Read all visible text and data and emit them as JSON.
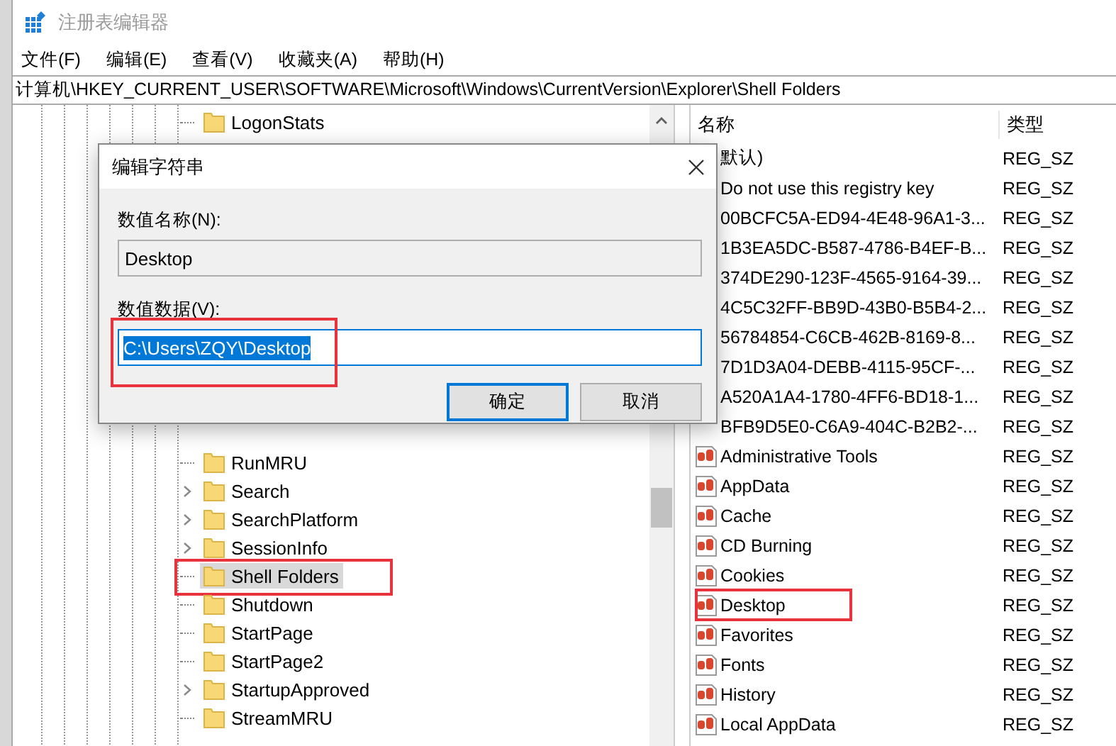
{
  "window": {
    "title": "注册表编辑器"
  },
  "menu": [
    "文件(F)",
    "编辑(E)",
    "查看(V)",
    "收藏夹(A)",
    "帮助(H)"
  ],
  "address": "计算机\\HKEY_CURRENT_USER\\SOFTWARE\\Microsoft\\Windows\\CurrentVersion\\Explorer\\Shell Folders",
  "tree": {
    "items_above": [
      {
        "label": "LogonStats",
        "expandable": false,
        "selected": false,
        "marked": false
      }
    ],
    "items_below": [
      {
        "label": "RunMRU",
        "expandable": false,
        "selected": false,
        "marked": false
      },
      {
        "label": "Search",
        "expandable": true,
        "selected": false,
        "marked": false
      },
      {
        "label": "SearchPlatform",
        "expandable": true,
        "selected": false,
        "marked": false
      },
      {
        "label": "SessionInfo",
        "expandable": true,
        "selected": false,
        "marked": false
      },
      {
        "label": "Shell Folders",
        "expandable": false,
        "selected": true,
        "marked": true
      },
      {
        "label": "Shutdown",
        "expandable": false,
        "selected": false,
        "marked": false
      },
      {
        "label": "StartPage",
        "expandable": false,
        "selected": false,
        "marked": false
      },
      {
        "label": "StartPage2",
        "expandable": false,
        "selected": false,
        "marked": false
      },
      {
        "label": "StartupApproved",
        "expandable": true,
        "selected": false,
        "marked": false
      },
      {
        "label": "StreamMRU",
        "expandable": false,
        "selected": false,
        "marked": false
      }
    ]
  },
  "list": {
    "columns": [
      "名称",
      "类型"
    ],
    "rows": [
      {
        "kind": "covered",
        "name": "默认)",
        "type": "REG_SZ",
        "marked": false
      },
      {
        "kind": "covered",
        "name": "Do not use this registry key",
        "type": "REG_SZ",
        "marked": false
      },
      {
        "kind": "covered",
        "name": "00BCFC5A-ED94-4E48-96A1-3...",
        "type": "REG_SZ",
        "marked": false
      },
      {
        "kind": "covered",
        "name": "1B3EA5DC-B587-4786-B4EF-B...",
        "type": "REG_SZ",
        "marked": false
      },
      {
        "kind": "covered",
        "name": "374DE290-123F-4565-9164-39...",
        "type": "REG_SZ",
        "marked": false
      },
      {
        "kind": "covered",
        "name": "4C5C32FF-BB9D-43B0-B5B4-2...",
        "type": "REG_SZ",
        "marked": false
      },
      {
        "kind": "covered",
        "name": "56784854-C6CB-462B-8169-8...",
        "type": "REG_SZ",
        "marked": false
      },
      {
        "kind": "covered",
        "name": "7D1D3A04-DEBB-4115-95CF-...",
        "type": "REG_SZ",
        "marked": false
      },
      {
        "kind": "covered",
        "name": "A520A1A4-1780-4FF6-BD18-1...",
        "type": "REG_SZ",
        "marked": false
      },
      {
        "kind": "covered",
        "name": "BFB9D5E0-C6A9-404C-B2B2-...",
        "type": "REG_SZ",
        "marked": false
      },
      {
        "kind": "string",
        "name": "Administrative Tools",
        "type": "REG_SZ",
        "marked": false
      },
      {
        "kind": "string",
        "name": "AppData",
        "type": "REG_SZ",
        "marked": false
      },
      {
        "kind": "string",
        "name": "Cache",
        "type": "REG_SZ",
        "marked": false
      },
      {
        "kind": "string",
        "name": "CD Burning",
        "type": "REG_SZ",
        "marked": false
      },
      {
        "kind": "string",
        "name": "Cookies",
        "type": "REG_SZ",
        "marked": false
      },
      {
        "kind": "string",
        "name": "Desktop",
        "type": "REG_SZ",
        "marked": true
      },
      {
        "kind": "string",
        "name": "Favorites",
        "type": "REG_SZ",
        "marked": false
      },
      {
        "kind": "string",
        "name": "Fonts",
        "type": "REG_SZ",
        "marked": false
      },
      {
        "kind": "string",
        "name": "History",
        "type": "REG_SZ",
        "marked": false
      },
      {
        "kind": "string",
        "name": "Local AppData",
        "type": "REG_SZ",
        "marked": false
      }
    ]
  },
  "dialog": {
    "title": "编辑字符串",
    "name_label": "数值名称(N):",
    "name_value": "Desktop",
    "data_label": "数值数据(V):",
    "data_value": "C:\\Users\\ZQY\\Desktop",
    "data_selected": true,
    "data_marked": true,
    "buttons": [
      {
        "label": "确定",
        "default": true
      },
      {
        "label": "取消",
        "default": false
      }
    ]
  }
}
